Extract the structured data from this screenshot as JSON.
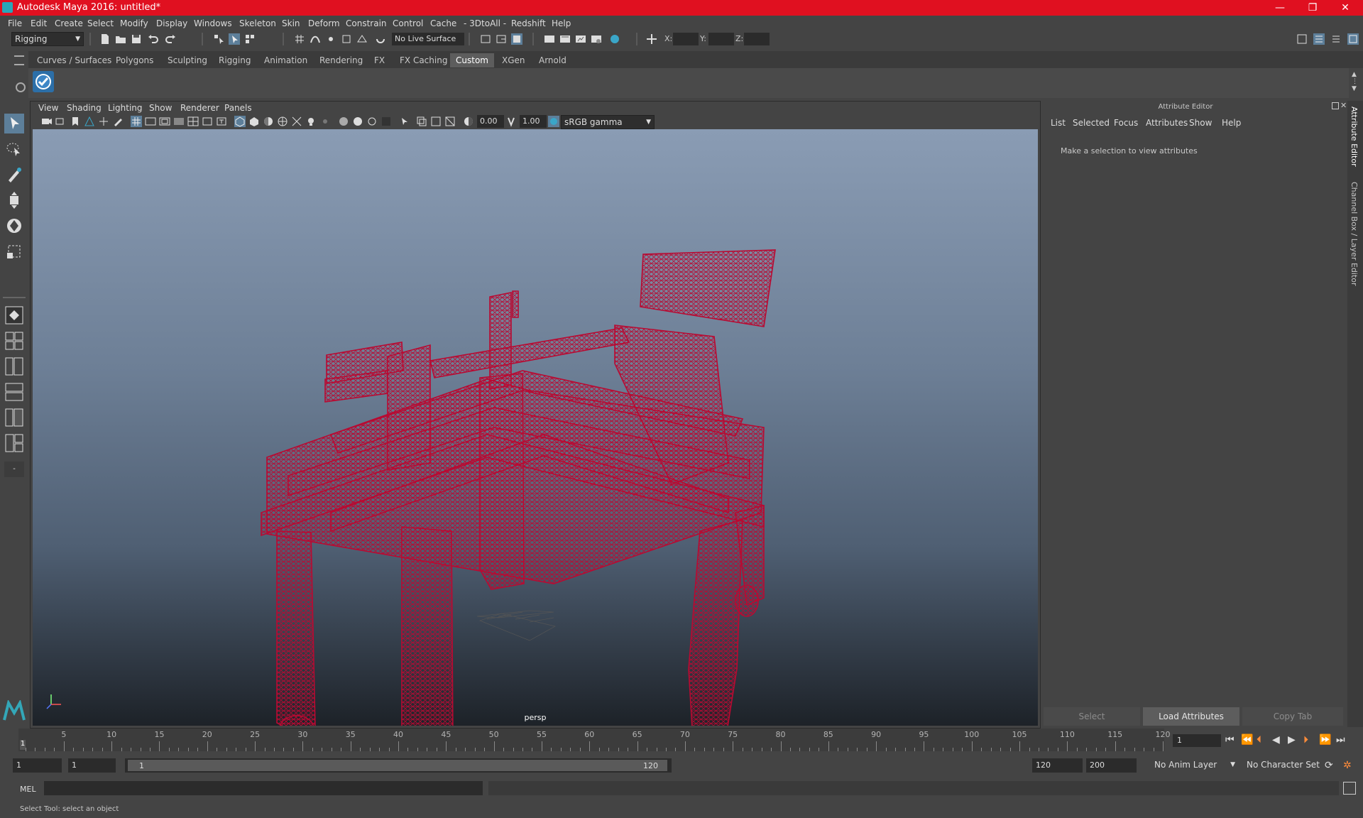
{
  "window": {
    "title": "Autodesk Maya 2016: untitled*",
    "controls": {
      "minimize": "—",
      "maximize": "❐",
      "close": "✕"
    }
  },
  "menubar": [
    "File",
    "Edit",
    "Create",
    "Select",
    "Modify",
    "Display",
    "Windows",
    "Skeleton",
    "Skin",
    "Deform",
    "Constrain",
    "Control",
    "Cache",
    "- 3DtoAll -",
    "Redshift",
    "Help"
  ],
  "statusline": {
    "menuset": "Rigging",
    "live_surface": "No Live Surface",
    "x_label": "X:",
    "y_label": "Y:",
    "z_label": "Z:"
  },
  "shelf": {
    "tabs": [
      "Curves / Surfaces",
      "Polygons",
      "Sculpting",
      "Rigging",
      "Animation",
      "Rendering",
      "FX",
      "FX Caching",
      "Custom",
      "XGen",
      "Arnold"
    ],
    "active_tab": "Custom"
  },
  "viewport": {
    "menus": [
      "View",
      "Shading",
      "Lighting",
      "Show",
      "Renderer",
      "Panels"
    ],
    "exposure": "0.00",
    "gamma": "1.00",
    "color_space": "sRGB gamma",
    "camera_label": "persp",
    "wireframe_color": "#b80a32"
  },
  "attribute_editor": {
    "title": "Attribute Editor",
    "menus": [
      "List",
      "Selected",
      "Focus",
      "Attributes",
      "Show",
      "Help"
    ],
    "message": "Make a selection to view attributes",
    "buttons": [
      "Select",
      "Load Attributes",
      "Copy Tab"
    ],
    "side_tabs": [
      "Attribute Editor",
      "Channel Box / Layer Editor"
    ]
  },
  "timeline": {
    "ticks": [
      "5",
      "10",
      "15",
      "20",
      "25",
      "30",
      "35",
      "40",
      "45",
      "50",
      "55",
      "60",
      "65",
      "70",
      "75",
      "80",
      "85",
      "90",
      "95",
      "100",
      "105",
      "110",
      "115",
      "120"
    ],
    "start_marker": "1",
    "current_frame": "1"
  },
  "range": {
    "start": "1",
    "playback_start": "1",
    "slider_start": "1",
    "slider_end": "120",
    "playback_end": "120",
    "end": "200",
    "anim_layer": "No Anim Layer",
    "character_set": "No Character Set"
  },
  "command_line": {
    "label": "MEL"
  },
  "help_line": "Select Tool: select an object"
}
